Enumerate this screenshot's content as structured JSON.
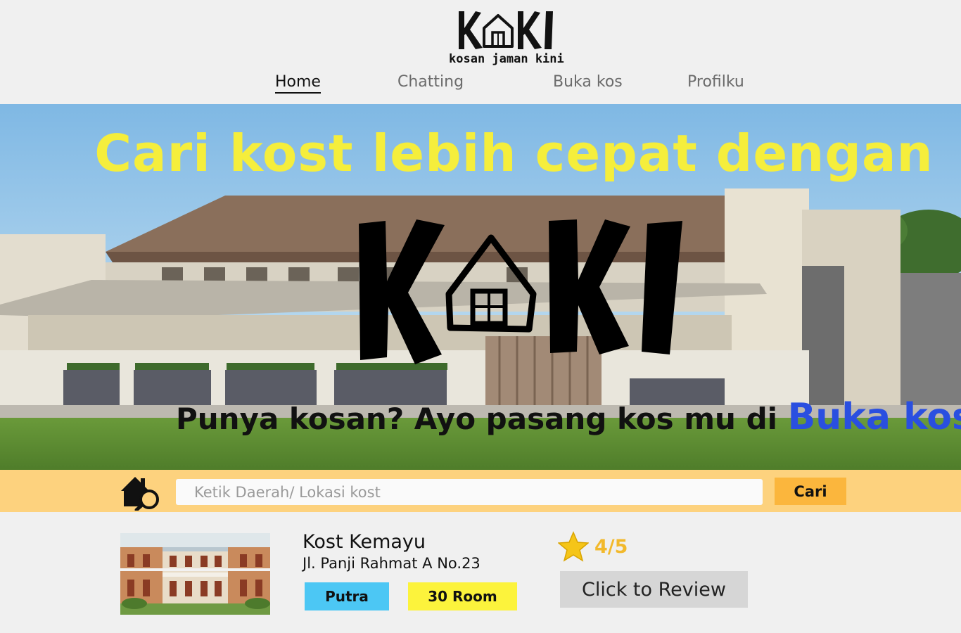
{
  "brand": {
    "name": "K KI",
    "tagline": "kosan jaman kini"
  },
  "nav": {
    "home": "Home",
    "chatting": "Chatting",
    "buka_kos": "Buka kos",
    "profil": "Profilku",
    "active": "Home"
  },
  "hero": {
    "title": "Cari kost lebih cepat dengan",
    "subtitle": "Punya kosan? Ayo pasang kos mu di",
    "subtitle_link": "Buka kos"
  },
  "search": {
    "placeholder": "Ketik Daerah/ Lokasi kost",
    "button": "Cari"
  },
  "listing": {
    "name": "Kost Kemayu",
    "address": "Jl. Panji Rahmat A No.23",
    "type": "Putra",
    "rooms": "30 Room",
    "rating": "4/5",
    "review_button": "Click to Review"
  },
  "colors": {
    "hero_title": "#f5ee3c",
    "link_blue": "#2a4fe0",
    "search_bar": "#fdd27e",
    "search_button": "#fbb63d",
    "tag_type": "#4cc7f4",
    "tag_room": "#fcf33c",
    "star": "#f2b92c"
  },
  "icons": {
    "logo_house": "house-icon",
    "search": "house-search-icon",
    "rating": "star-icon"
  }
}
